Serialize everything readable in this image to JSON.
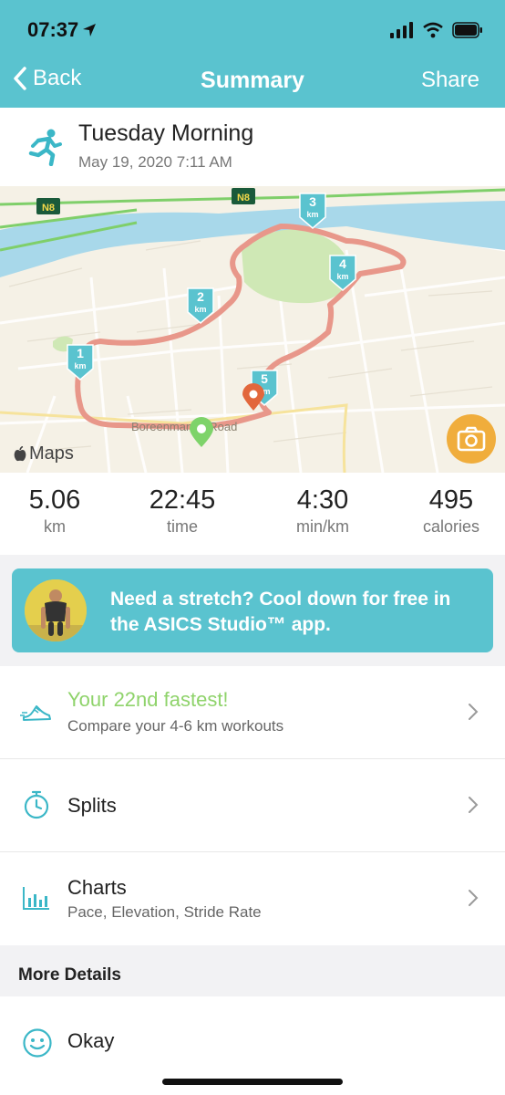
{
  "status_bar": {
    "time": "07:37"
  },
  "nav": {
    "back_label": "Back",
    "title": "Summary",
    "share_label": "Share"
  },
  "workout": {
    "title": "Tuesday Morning",
    "date": "May 19, 2020 7:11 AM"
  },
  "map": {
    "road_label": "Boreenmanna Road",
    "road_shield": "N8",
    "km_markers": [
      "1",
      "2",
      "3",
      "4",
      "5"
    ],
    "km_unit": "km",
    "attribution": "Maps",
    "colors": {
      "route": "#e8978a",
      "marker": "#5ac3cf",
      "start": "#7ed36a",
      "finish": "#e2673c",
      "water": "#a8d8ea",
      "park": "#cfe8b5"
    }
  },
  "stats": [
    {
      "value": "5.06",
      "unit": "km"
    },
    {
      "value": "22:45",
      "unit": "time"
    },
    {
      "value": "4:30",
      "unit": "min/km"
    },
    {
      "value": "495",
      "unit": "calories"
    }
  ],
  "promo": {
    "text": "Need a stretch? Cool down for free in the ASICS Studio™ app."
  },
  "rows": {
    "fastest": {
      "label": "Your 22nd fastest!",
      "sub": "Compare your 4-6 km workouts",
      "icon": "shoe-icon"
    },
    "splits": {
      "label": "Splits",
      "icon": "stopwatch-icon"
    },
    "charts": {
      "label": "Charts",
      "sub": "Pace, Elevation, Stride Rate",
      "icon": "bar-chart-icon"
    }
  },
  "more_details": {
    "heading": "More Details",
    "feeling": "Okay",
    "feeling_icon": "smiley-icon"
  },
  "accent_color": "#5ac3cf",
  "highlight_color": "#8fd36b"
}
